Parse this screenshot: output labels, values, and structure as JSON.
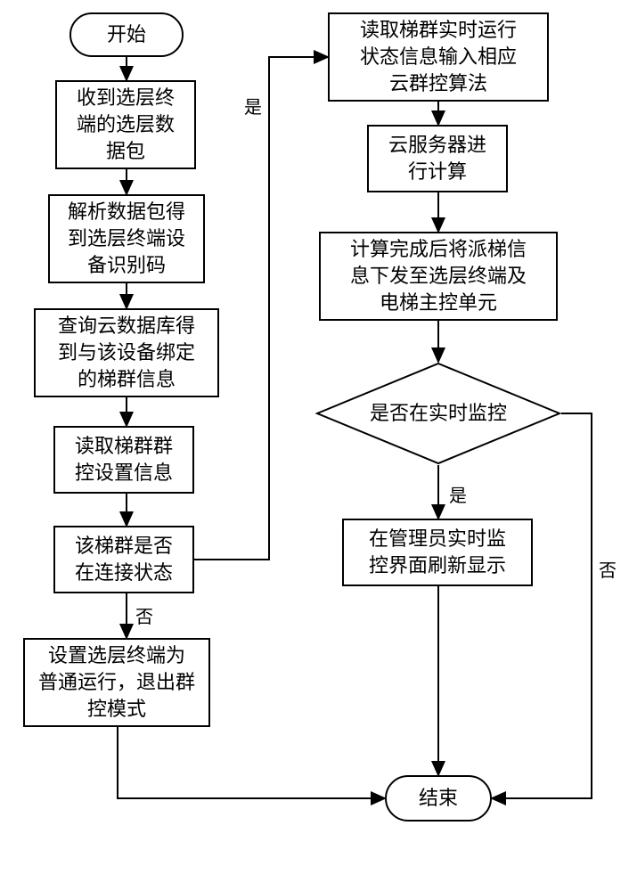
{
  "start": "开始",
  "end": "结束",
  "step_receive": "收到选层终\n端的选层数\n据包",
  "step_parse": "解析数据包得\n到选层终端设\n备识别码",
  "step_query": "查询云数据库得\n到与该设备绑定\n的梯群信息",
  "step_readsettings": "读取梯群群\n控设置信息",
  "step_connected": "该梯群是否\n在连接状态",
  "step_setnormal": "设置选层终端为\n普通运行，退出群\n控模式",
  "step_readstatus": "读取梯群实时运行\n状态信息输入相应\n云群控算法",
  "step_compute": "云服务器进\n行计算",
  "step_dispatch": "计算完成后将派梯信\n息下发至选层终端及\n电梯主控单元",
  "step_monitorq": "是否在实时监控",
  "step_refresh": "在管理员实时监\n控界面刷新显示",
  "label_yes": "是",
  "label_no": "否"
}
